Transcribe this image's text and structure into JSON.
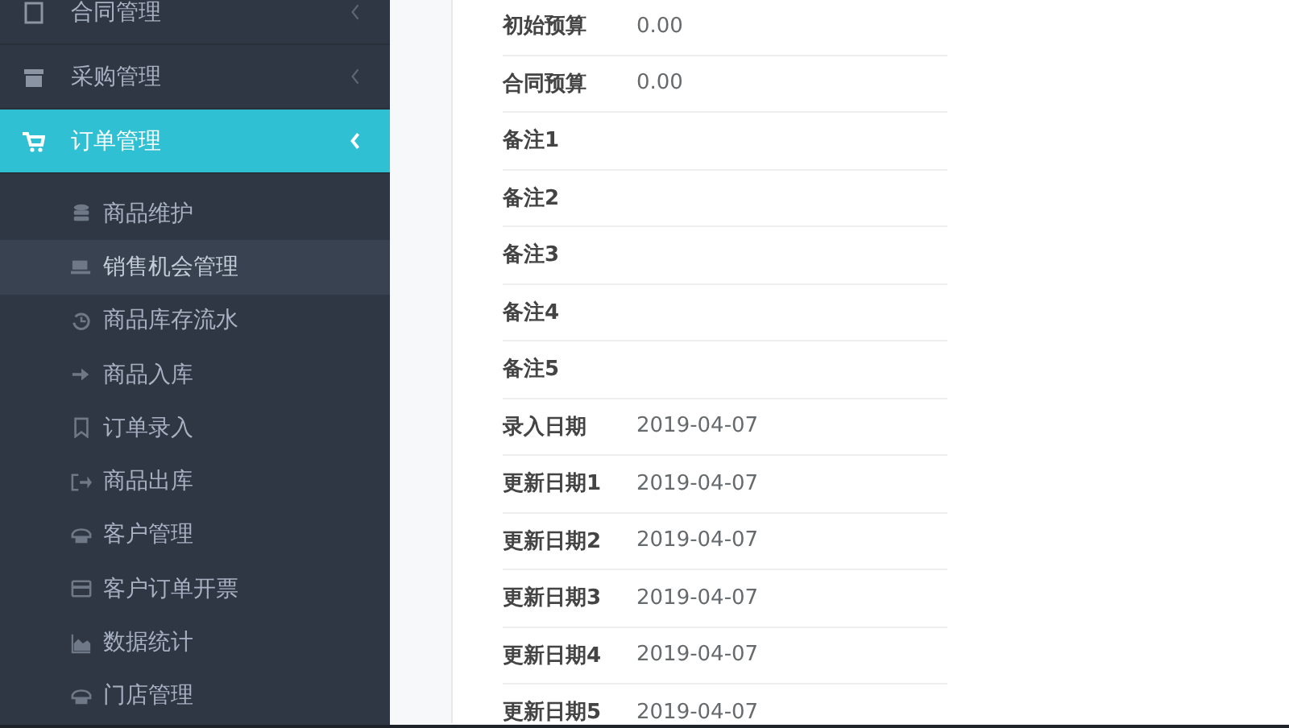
{
  "sidebar": {
    "items": [
      {
        "label": "合同管理",
        "selected": false
      },
      {
        "label": "采购管理",
        "selected": false
      },
      {
        "label": "订单管理",
        "selected": true,
        "children": [
          {
            "label": "商品维护",
            "selected": false
          },
          {
            "label": "销售机会管理",
            "selected": true
          },
          {
            "label": "商品库存流水",
            "selected": false
          },
          {
            "label": "商品入库",
            "selected": false
          },
          {
            "label": "订单录入",
            "selected": false
          },
          {
            "label": "商品出库",
            "selected": false
          },
          {
            "label": "客户管理",
            "selected": false
          },
          {
            "label": "客户订单开票",
            "selected": false
          },
          {
            "label": "数据统计",
            "selected": false
          },
          {
            "label": "门店管理",
            "selected": false
          }
        ]
      }
    ]
  },
  "details": {
    "rows": [
      {
        "label": "初始预算",
        "value": "0.00"
      },
      {
        "label": "合同预算",
        "value": "0.00"
      },
      {
        "label": "备注1"
      },
      {
        "label": "备注2"
      },
      {
        "label": "备注3"
      },
      {
        "label": "备注4"
      },
      {
        "label": "备注5"
      },
      {
        "label": "录入日期",
        "value": "2019-04-07"
      },
      {
        "label": "更新日期1",
        "value": "2019-04-07"
      },
      {
        "label": "更新日期2",
        "value": "2019-04-07"
      },
      {
        "label": "更新日期3",
        "value": "2019-04-07"
      },
      {
        "label": "更新日期4",
        "value": "2019-04-07"
      },
      {
        "label": "更新日期5",
        "value": "2019-04-07"
      }
    ]
  }
}
